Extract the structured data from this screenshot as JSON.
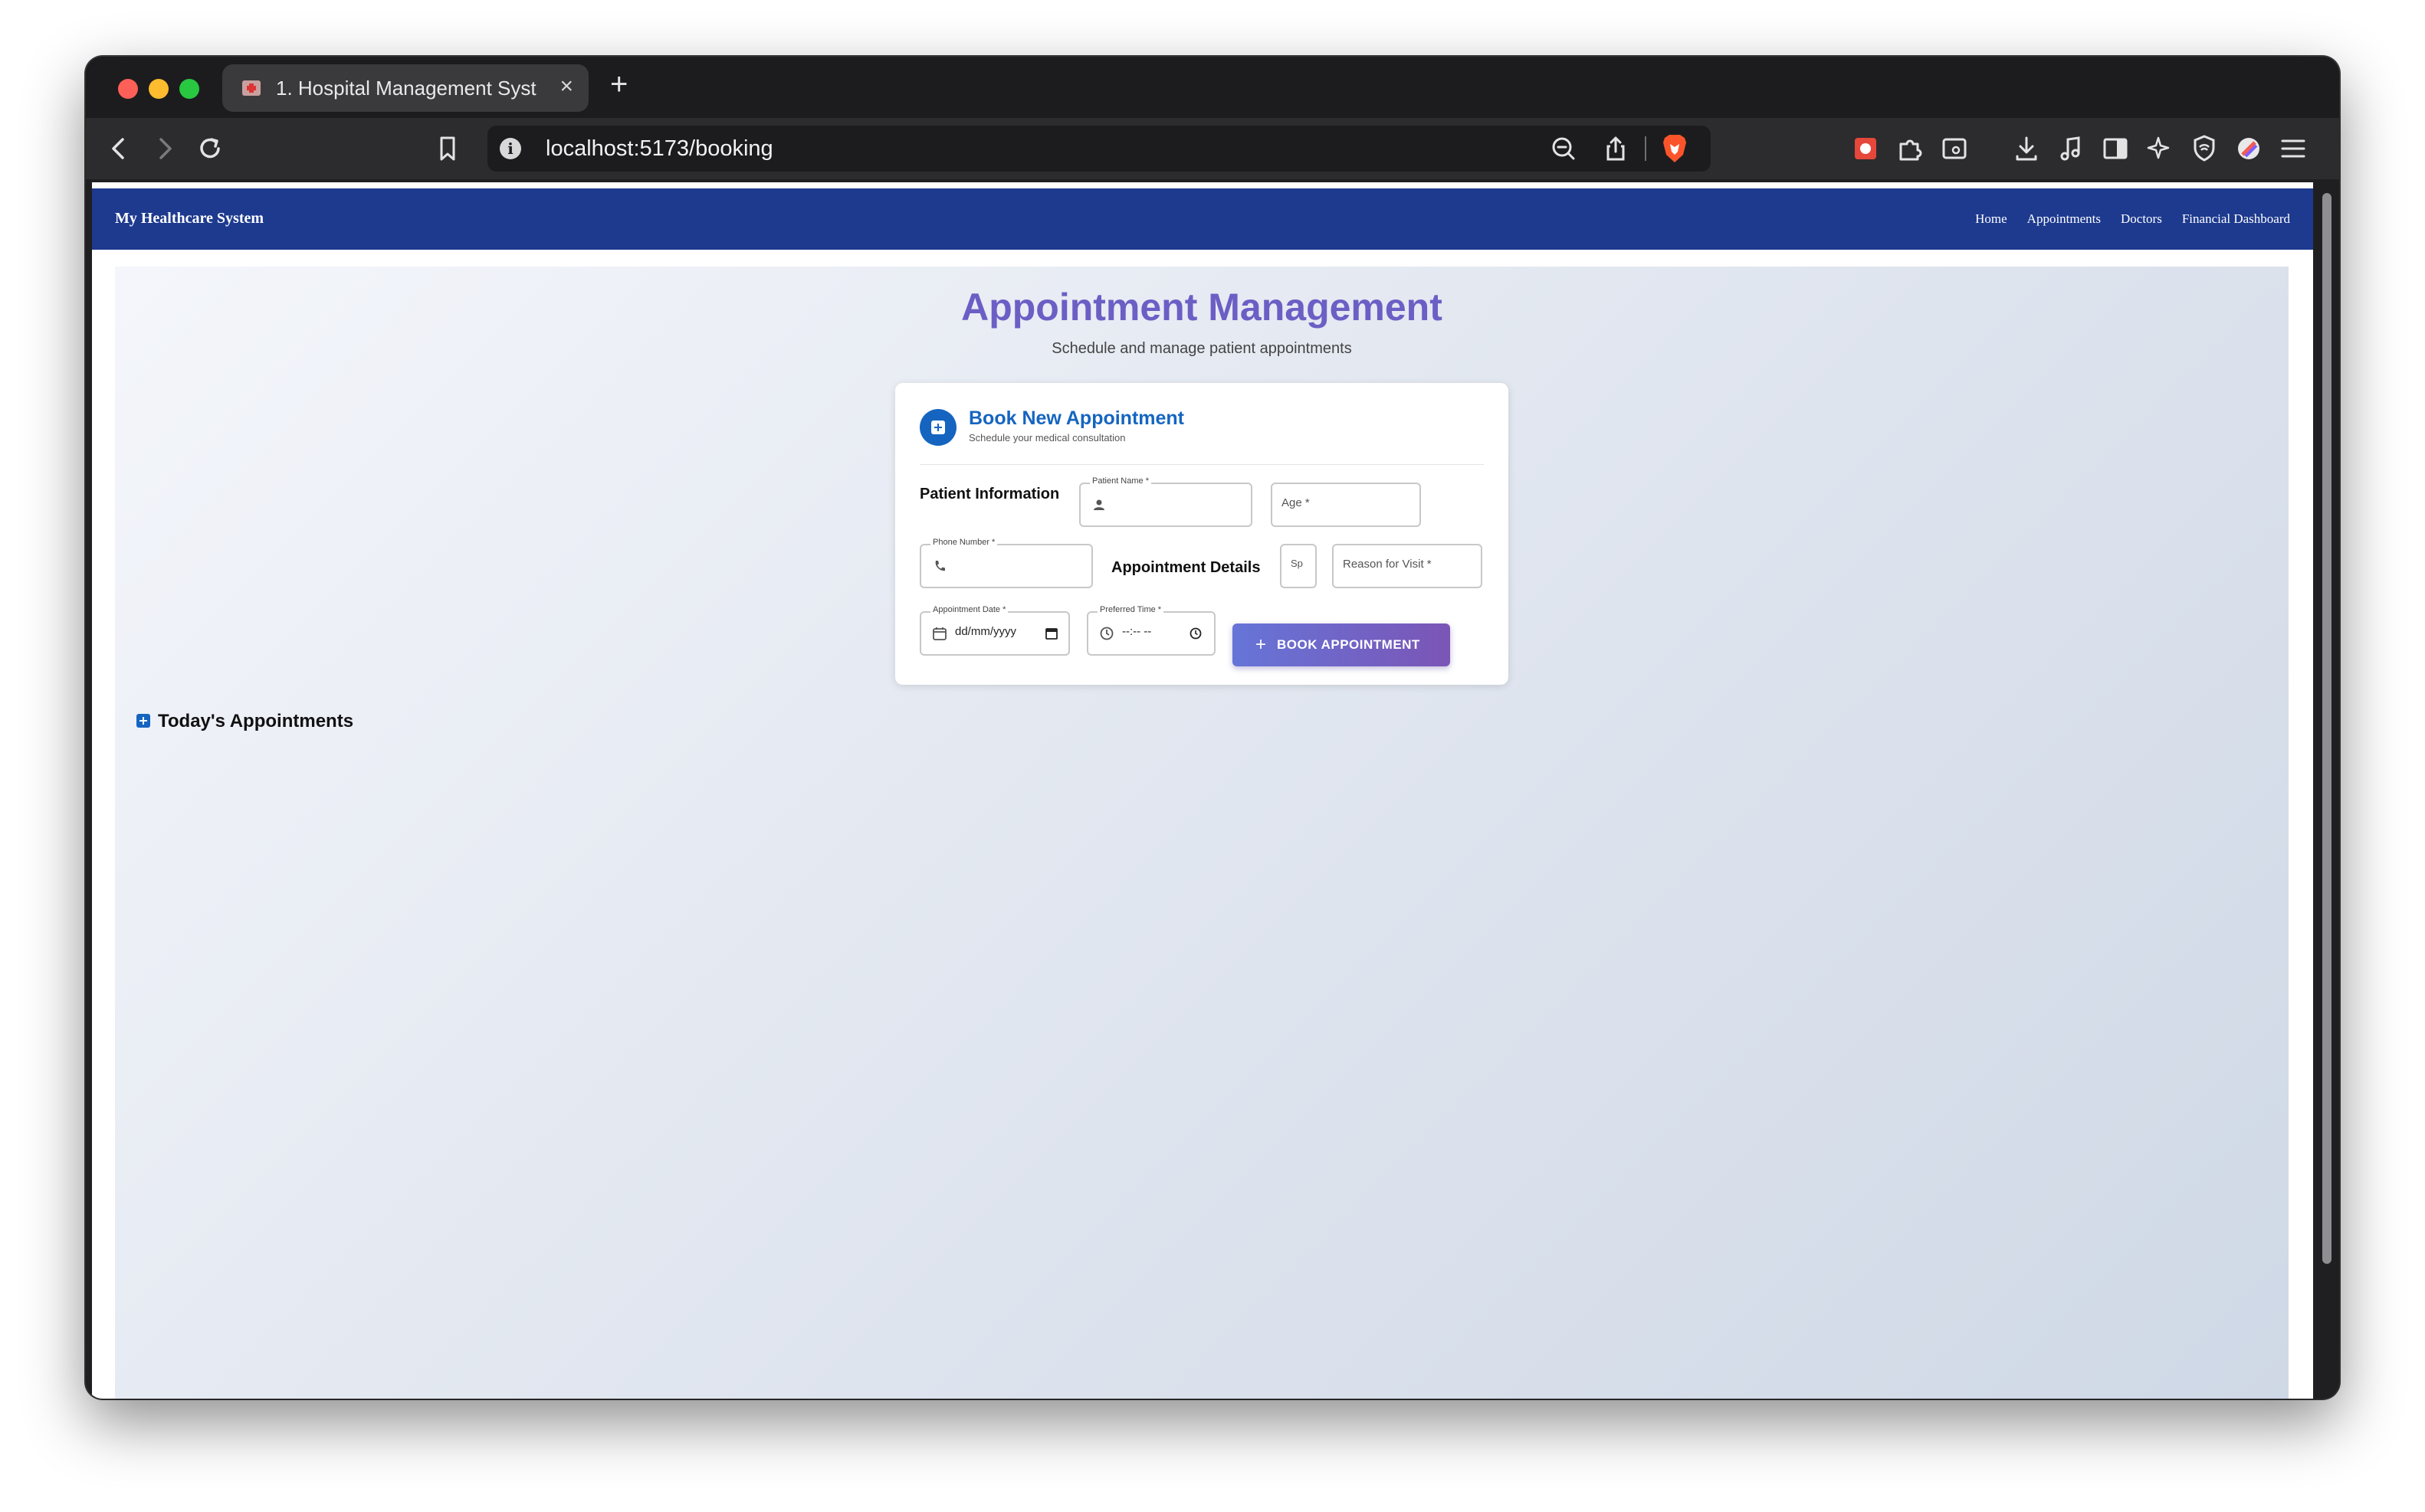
{
  "browser": {
    "tab_title": "1. Hospital Management System",
    "tab_close": "×",
    "new_tab": "+",
    "url": "localhost:5173/booking",
    "info_glyph": "i",
    "icons": [
      "back-icon",
      "forward-icon",
      "reload-icon",
      "bookmark-icon",
      "zoom-out-icon",
      "share-icon",
      "brave-shield-icon",
      "extension-1-icon",
      "extensions-icon",
      "screenshot-icon",
      "downloads-icon",
      "media-icon",
      "sidebar-icon",
      "leo-ai-icon",
      "vpn-icon",
      "wallet-icon",
      "menu-icon"
    ]
  },
  "app": {
    "brand": "My Healthcare System",
    "nav": [
      "Home",
      "Appointments",
      "Doctors",
      "Financial Dashboard"
    ]
  },
  "page": {
    "title": "Appointment Management",
    "subtitle": "Schedule and manage patient appointments"
  },
  "booking_card": {
    "title": "Book New Appointment",
    "subtitle": "Schedule your medical consultation",
    "patient_section": "Patient Information",
    "patient_name_label": "Patient Name *",
    "age_placeholder": "Age *",
    "phone_label": "Phone Number *",
    "appointment_section": "Appointment Details",
    "specialty_truncated": "Sp",
    "reason_placeholder": "Reason for Visit *",
    "date_label": "Appointment Date *",
    "date_value": "dd/mm/yyyy",
    "time_label": "Preferred Time *",
    "time_value": "--:-- --",
    "submit_plus": "+",
    "submit_label": "BOOK APPOINTMENT"
  },
  "today": {
    "label": "Today's Appointments"
  },
  "colors": {
    "nav_bg": "#1d3a8f",
    "title": "#6b5fc5",
    "accent": "#1565c0",
    "button_start": "#6675d8",
    "button_end": "#7b55b6"
  }
}
